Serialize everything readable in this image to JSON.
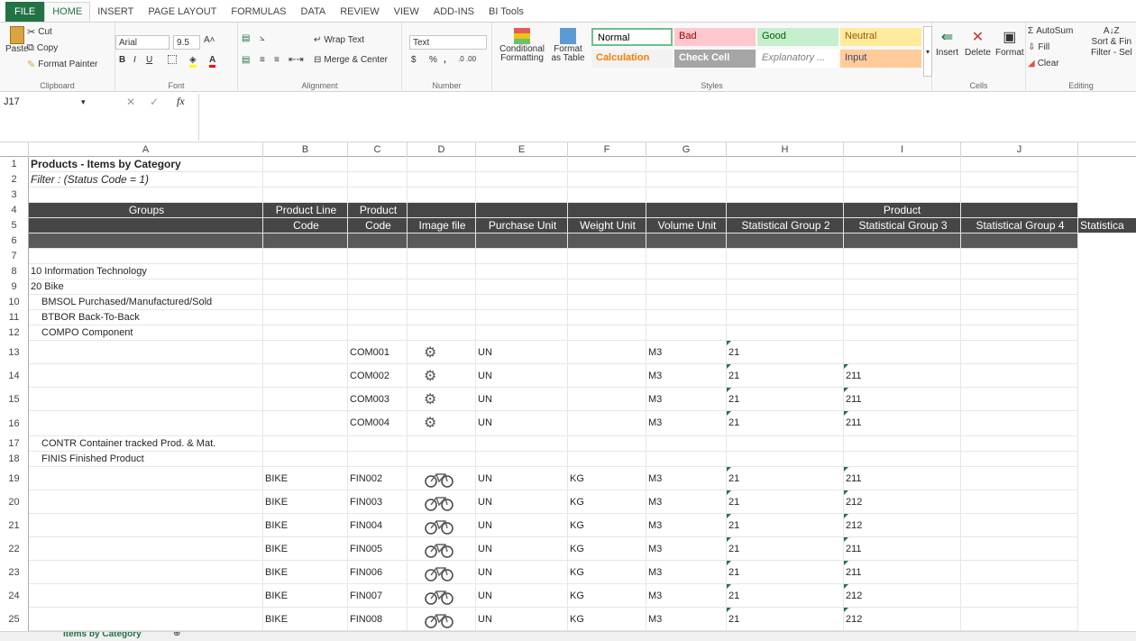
{
  "tabs": [
    "FILE",
    "HOME",
    "INSERT",
    "PAGE LAYOUT",
    "FORMULAS",
    "DATA",
    "REVIEW",
    "VIEW",
    "ADD-INS",
    "BI Tools"
  ],
  "clipboard": {
    "paste": "Paste",
    "cut": "Cut",
    "copy": "Copy",
    "format_painter": "Format Painter",
    "label": "Clipboard"
  },
  "font": {
    "name": "Arial",
    "size": "9.5",
    "label": "Font"
  },
  "alignment": {
    "wrap": "Wrap Text",
    "merge": "Merge & Center",
    "label": "Alignment"
  },
  "number": {
    "format": "Text",
    "currency": "$",
    "percent": "%",
    "comma": ",",
    "label": "Number"
  },
  "styles_group": {
    "cond": "Conditional Formatting",
    "fmt_table": "Format as Table",
    "label": "Styles",
    "cells": [
      {
        "name": "Normal",
        "bg": "#ffffff",
        "fg": "#000000"
      },
      {
        "name": "Bad",
        "bg": "#ffc7ce",
        "fg": "#9c0006"
      },
      {
        "name": "Good",
        "bg": "#c6efce",
        "fg": "#006100"
      },
      {
        "name": "Neutral",
        "bg": "#ffeb9c",
        "fg": "#9c5700"
      },
      {
        "name": "Calculation",
        "bg": "#f2f2f2",
        "fg": "#fa7d00"
      },
      {
        "name": "Check Cell",
        "bg": "#a5a5a5",
        "fg": "#ffffff"
      },
      {
        "name": "Explanatory ...",
        "bg": "#ffffff",
        "fg": "#7f7f7f"
      },
      {
        "name": "Input",
        "bg": "#ffcc99",
        "fg": "#3f3f76"
      }
    ]
  },
  "cells_group": {
    "insert": "Insert",
    "delete": "Delete",
    "format": "Format",
    "label": "Cells"
  },
  "editing": {
    "autosum": "AutoSum",
    "fill": "Fill",
    "clear": "Clear",
    "sort": "Sort & Fin",
    "filter": "Filter - Sel",
    "label": "Editing"
  },
  "namebox": "J17",
  "fx": "fx",
  "columns": [
    "A",
    "B",
    "C",
    "D",
    "E",
    "F",
    "G",
    "H",
    "I",
    "J"
  ],
  "row_numbers": [
    "1",
    "2",
    "3",
    "4",
    "5",
    "6",
    "7",
    "8",
    "9",
    "10",
    "11",
    "12",
    "13",
    "14",
    "15",
    "16",
    "17",
    "18",
    "19",
    "20",
    "21",
    "22",
    "23",
    "24",
    "25"
  ],
  "title": "Products - Items by Category",
  "filter": "Filter : (Status Code = 1)",
  "headers4": {
    "groups": "Groups",
    "pline": "Product Line",
    "pcode": "Product",
    "product": "Product"
  },
  "headers5": {
    "pline": "Code",
    "pcode": "Code",
    "image": "Image file",
    "purchase": "Purchase Unit",
    "weight": "Weight Unit",
    "volume": "Volume Unit",
    "sg2": "Statistical Group 2",
    "sg3": "Statistical Group 3",
    "sg4": "Statistical Group 4",
    "sg5": "Statistica"
  },
  "groups": {
    "r8": "10  Information Technology",
    "r9": "20  Bike",
    "r10": "BMSOL  Purchased/Manufactured/Sold",
    "r11": "BTBOR  Back-To-Back",
    "r12": "COMPO  Component",
    "r17": "CONTR  Container tracked Prod. & Mat.",
    "r18": "FINIS  Finished Product"
  },
  "items": [
    {
      "row": "13",
      "line": "",
      "code": "COM001",
      "pu": "UN",
      "wu": "",
      "vu": "M3",
      "sg2": "21",
      "sg3": ""
    },
    {
      "row": "14",
      "line": "",
      "code": "COM002",
      "pu": "UN",
      "wu": "",
      "vu": "M3",
      "sg2": "21",
      "sg3": "211"
    },
    {
      "row": "15",
      "line": "",
      "code": "COM003",
      "pu": "UN",
      "wu": "",
      "vu": "M3",
      "sg2": "21",
      "sg3": "211"
    },
    {
      "row": "16",
      "line": "",
      "code": "COM004",
      "pu": "UN",
      "wu": "",
      "vu": "M3",
      "sg2": "21",
      "sg3": "211"
    },
    {
      "row": "19",
      "line": "BIKE",
      "code": "FIN002",
      "pu": "UN",
      "wu": "KG",
      "vu": "M3",
      "sg2": "21",
      "sg3": "211"
    },
    {
      "row": "20",
      "line": "BIKE",
      "code": "FIN003",
      "pu": "UN",
      "wu": "KG",
      "vu": "M3",
      "sg2": "21",
      "sg3": "212"
    },
    {
      "row": "21",
      "line": "BIKE",
      "code": "FIN004",
      "pu": "UN",
      "wu": "KG",
      "vu": "M3",
      "sg2": "21",
      "sg3": "212"
    },
    {
      "row": "22",
      "line": "BIKE",
      "code": "FIN005",
      "pu": "UN",
      "wu": "KG",
      "vu": "M3",
      "sg2": "21",
      "sg3": "211"
    },
    {
      "row": "23",
      "line": "BIKE",
      "code": "FIN006",
      "pu": "UN",
      "wu": "KG",
      "vu": "M3",
      "sg2": "21",
      "sg3": "211"
    },
    {
      "row": "24",
      "line": "BIKE",
      "code": "FIN007",
      "pu": "UN",
      "wu": "KG",
      "vu": "M3",
      "sg2": "21",
      "sg3": "212"
    },
    {
      "row": "25",
      "line": "BIKE",
      "code": "FIN008",
      "pu": "UN",
      "wu": "KG",
      "vu": "M3",
      "sg2": "21",
      "sg3": "212"
    }
  ],
  "sheet_tab": "Items by Category"
}
